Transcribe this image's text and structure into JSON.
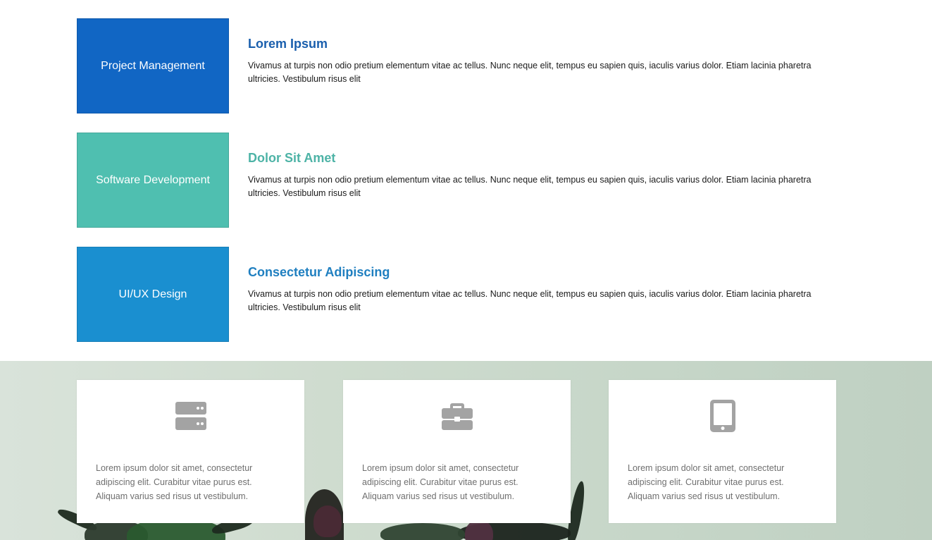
{
  "services": [
    {
      "box_label": "Project Management",
      "box_color": "#1166c4",
      "title": "Lorem Ipsum",
      "title_color": "#1a5fad",
      "description": "Vivamus at turpis non odio pretium elementum vitae ac tellus. Nunc neque elit, tempus eu sapien quis, iaculis varius dolor. Etiam lacinia pharetra ultricies. Vestibulum risus elit"
    },
    {
      "box_label": "Software Development",
      "box_color": "#4fbfb0",
      "title": "Dolor Sit Amet",
      "title_color": "#4db3a6",
      "description": "Vivamus at turpis non odio pretium elementum vitae ac tellus. Nunc neque elit, tempus eu sapien quis, iaculis varius dolor. Etiam lacinia pharetra ultricies. Vestibulum risus elit"
    },
    {
      "box_label": "UI/UX Design",
      "box_color": "#1a8fd0",
      "title": "Consectetur Adipiscing",
      "title_color": "#1f7fc0",
      "description": "Vivamus at turpis non odio pretium elementum vitae ac tellus. Nunc neque elit, tempus eu sapien quis, iaculis varius dolor. Etiam lacinia pharetra ultricies. Vestibulum risus elit"
    }
  ],
  "features": [
    {
      "icon": "server-icon",
      "text": "Lorem ipsum dolor sit amet, consectetur adipiscing elit. Curabitur vitae purus est. Aliquam varius sed risus ut vestibulum."
    },
    {
      "icon": "briefcase-icon",
      "text": "Lorem ipsum dolor sit amet, consectetur adipiscing elit. Curabitur vitae purus est. Aliquam varius sed risus ut vestibulum."
    },
    {
      "icon": "tablet-icon",
      "text": "Lorem ipsum dolor sit amet, consectetur adipiscing elit. Curabitur vitae purus est. Aliquam varius sed risus ut vestibulum."
    }
  ],
  "colors": {
    "icon_gray": "#a3a3a3",
    "card_text": "#6f6f6f"
  }
}
